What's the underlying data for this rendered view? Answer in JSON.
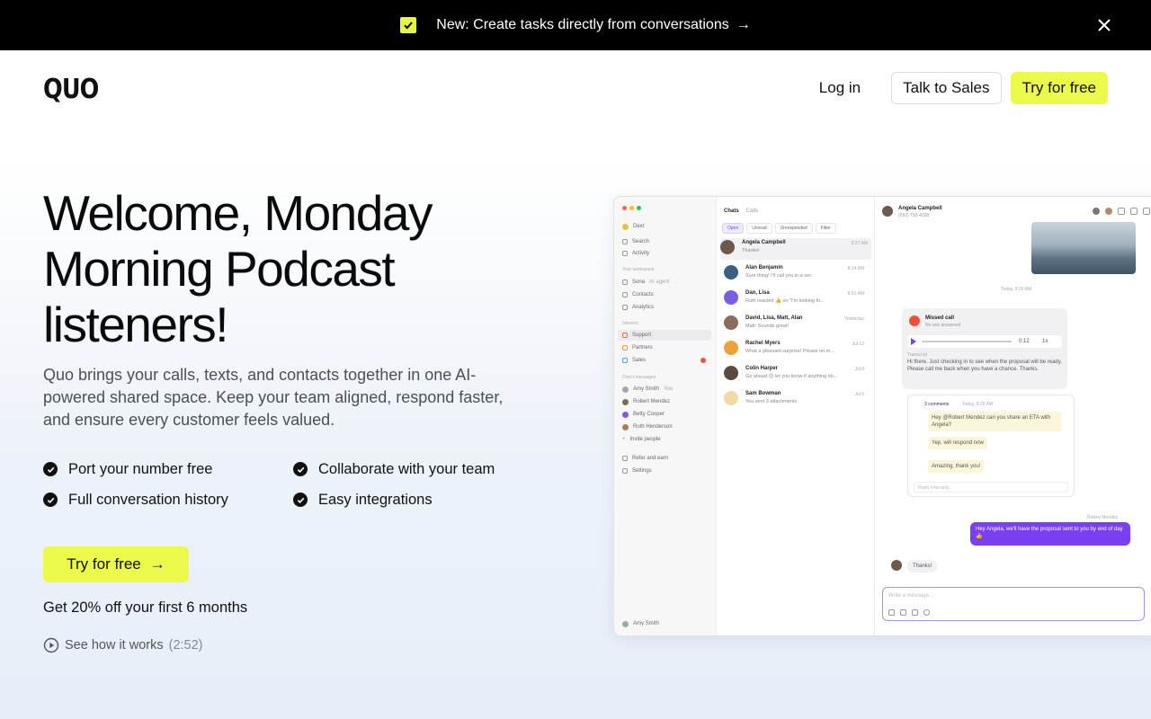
{
  "announcement": {
    "text": "New: Create tasks directly from conversations",
    "arrow": "→",
    "check_icon": "check-square-icon",
    "accent": "#ebfa4a"
  },
  "header": {
    "logo": "QUO",
    "login": "Log in",
    "talk_to_sales": "Talk to Sales",
    "try_free": "Try for free"
  },
  "hero": {
    "title": "Welcome, Monday Morning Podcast listeners!",
    "subtitle": "Quo brings your calls, texts, and contacts together in one AI-powered shared space. Keep your team aligned, respond faster, and ensure every customer feels valued.",
    "features": [
      "Port your number free",
      "Collaborate with your team",
      "Full conversation history",
      "Easy integrations"
    ],
    "cta_label": "Try for free",
    "cta_arrow": "→",
    "discount": "Get 20% off your first 6 months",
    "how_label": "See how it works",
    "how_time": "(2:52)"
  },
  "app_preview": {
    "sidebar": {
      "workspace": "Dext",
      "items_top": [
        "Search",
        "Activity"
      ],
      "workspace_head": "Your workspace",
      "items_ws": [
        "Sona",
        "Contacts",
        "Analytics"
      ],
      "sona_tag": "AI agent",
      "inboxes_head": "Inboxes",
      "inboxes": [
        "Support",
        "Partners",
        "Sales"
      ],
      "dm_head": "Direct messages",
      "dms": [
        "Amy Smith",
        "Robert Mendez",
        "Betty Cooper",
        "Ruth Henderson",
        "Invite people"
      ],
      "you_tag": "You",
      "bottom": [
        "Refer and earn",
        "Settings"
      ],
      "footer_user": "Amy Smith"
    },
    "list": {
      "tabs": [
        "Chats",
        "Calls"
      ],
      "filters": [
        "Open",
        "Unread",
        "Unresponded",
        "Filter"
      ],
      "conversations": [
        {
          "name": "Angela Campbell",
          "preview": "Thanks!",
          "time": "8:27 AM"
        },
        {
          "name": "Alan Benjamin",
          "preview": "Sure thing! I'll call you in a sec",
          "time": "8:14 AM"
        },
        {
          "name": "Dan, Lisa",
          "preview": "Ruth reacted 👍 on \"I'm looking fo...",
          "time": "8:01 AM"
        },
        {
          "name": "David, Lisa, Matt, Alan",
          "preview": "Matt: Sounds great!",
          "time": "Yesterday"
        },
        {
          "name": "Rachel Myers",
          "preview": "What a pleasant surprise! Please let m...",
          "time": "Jul 12"
        },
        {
          "name": "Colin Harper",
          "preview": "Go ahead 😊 let you know if anything do...",
          "time": "Jul 8"
        },
        {
          "name": "Sam Bowman",
          "preview": "You sent 3 attachments",
          "time": "Jul 6"
        }
      ]
    },
    "chat": {
      "contact_name": "Angela Campbell",
      "contact_phone": "(650) 793-4328",
      "date_label": "Today, 8:26 AM",
      "missed_call": "Missed call",
      "missed_sub": "No one answered",
      "audio_time": "0:12",
      "audio_speed": "1x",
      "transcript_label": "Transcript",
      "transcript": "Hi there. Just checking in to see when the proposal will be ready. Please call me back when you have a chance. Thanks.",
      "thread_head": "3 comments",
      "thread_time": "Today, 8:28 AM",
      "thread": [
        "Hey @Robert Mendez can you share an ETA with Angela?",
        "Yep, will respond now",
        "Amazing, thank you!"
      ],
      "reply_placeholder": "Reply internally...",
      "sender_label": "Robert Mendez",
      "outgoing": "Hey Angela, we'll have the proposal sent to you by end of day 👍",
      "incoming": "Thanks!",
      "composer_placeholder": "Write a message..."
    }
  }
}
